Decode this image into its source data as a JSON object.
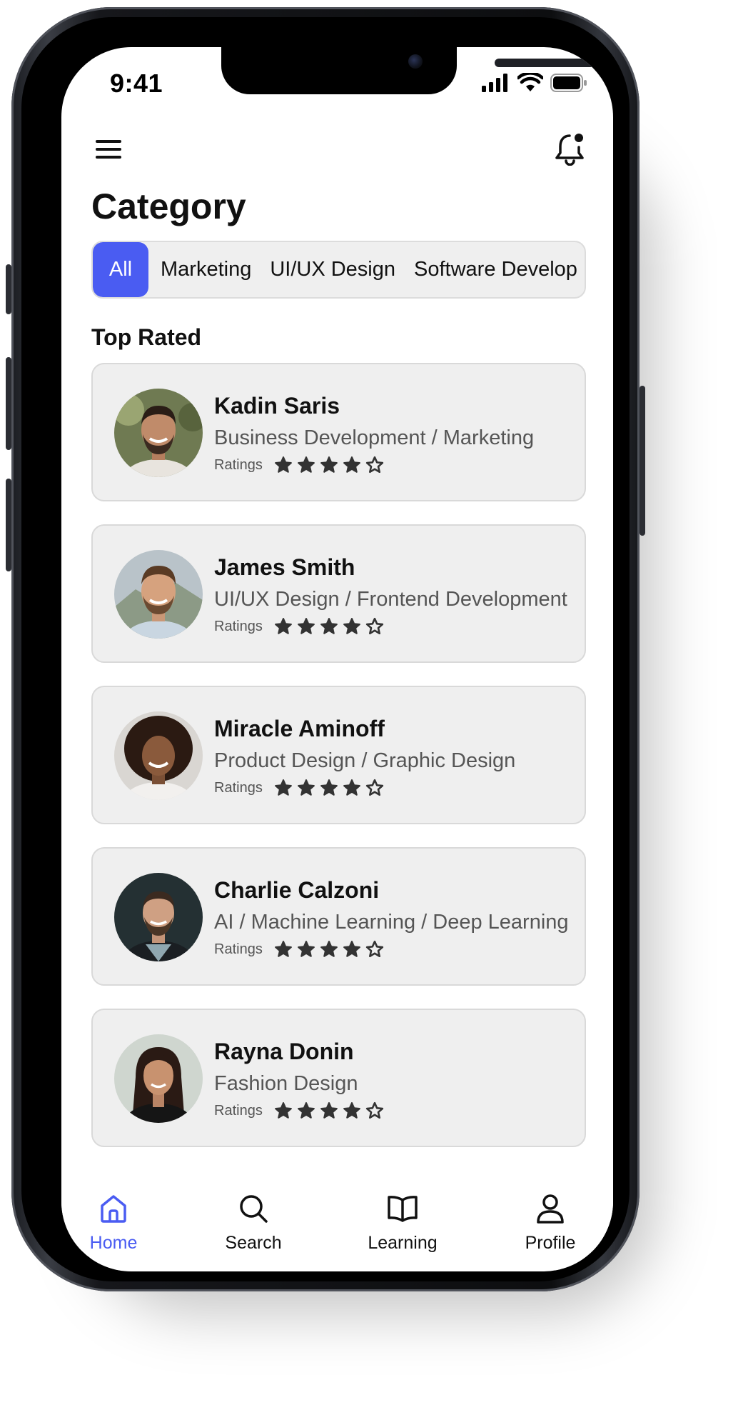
{
  "status_bar": {
    "time": "9:41"
  },
  "header": {
    "title": "Category"
  },
  "tabs": [
    {
      "label": "All",
      "active": true
    },
    {
      "label": "Marketing",
      "active": false
    },
    {
      "label": "UI/UX Design",
      "active": false
    },
    {
      "label": "Software Develop",
      "active": false
    }
  ],
  "section": {
    "title": "Top Rated"
  },
  "mentors": [
    {
      "name": "Kadin Saris",
      "role": "Business Development / Marketing",
      "ratings_label": "Ratings",
      "rating": 4,
      "max_rating": 5
    },
    {
      "name": "James Smith",
      "role": "UI/UX Design / Frontend Development",
      "ratings_label": "Ratings",
      "rating": 4,
      "max_rating": 5
    },
    {
      "name": "Miracle Aminoff",
      "role": "Product Design / Graphic Design",
      "ratings_label": "Ratings",
      "rating": 4,
      "max_rating": 5
    },
    {
      "name": "Charlie Calzoni",
      "role": "AI / Machine Learning / Deep Learning",
      "ratings_label": "Ratings",
      "rating": 4,
      "max_rating": 5
    },
    {
      "name": "Rayna Donin",
      "role": "Fashion Design",
      "ratings_label": "Ratings",
      "rating": 4,
      "max_rating": 5
    }
  ],
  "bottom_nav": [
    {
      "label": "Home",
      "icon": "home-icon",
      "active": true
    },
    {
      "label": "Search",
      "icon": "search-icon",
      "active": false
    },
    {
      "label": "Learning",
      "icon": "book-icon",
      "active": false
    },
    {
      "label": "Profile",
      "icon": "user-icon",
      "active": false
    }
  ],
  "colors": {
    "accent": "#4a5cf2",
    "card_bg": "#efefef",
    "text": "#111111",
    "muted": "#555555"
  }
}
